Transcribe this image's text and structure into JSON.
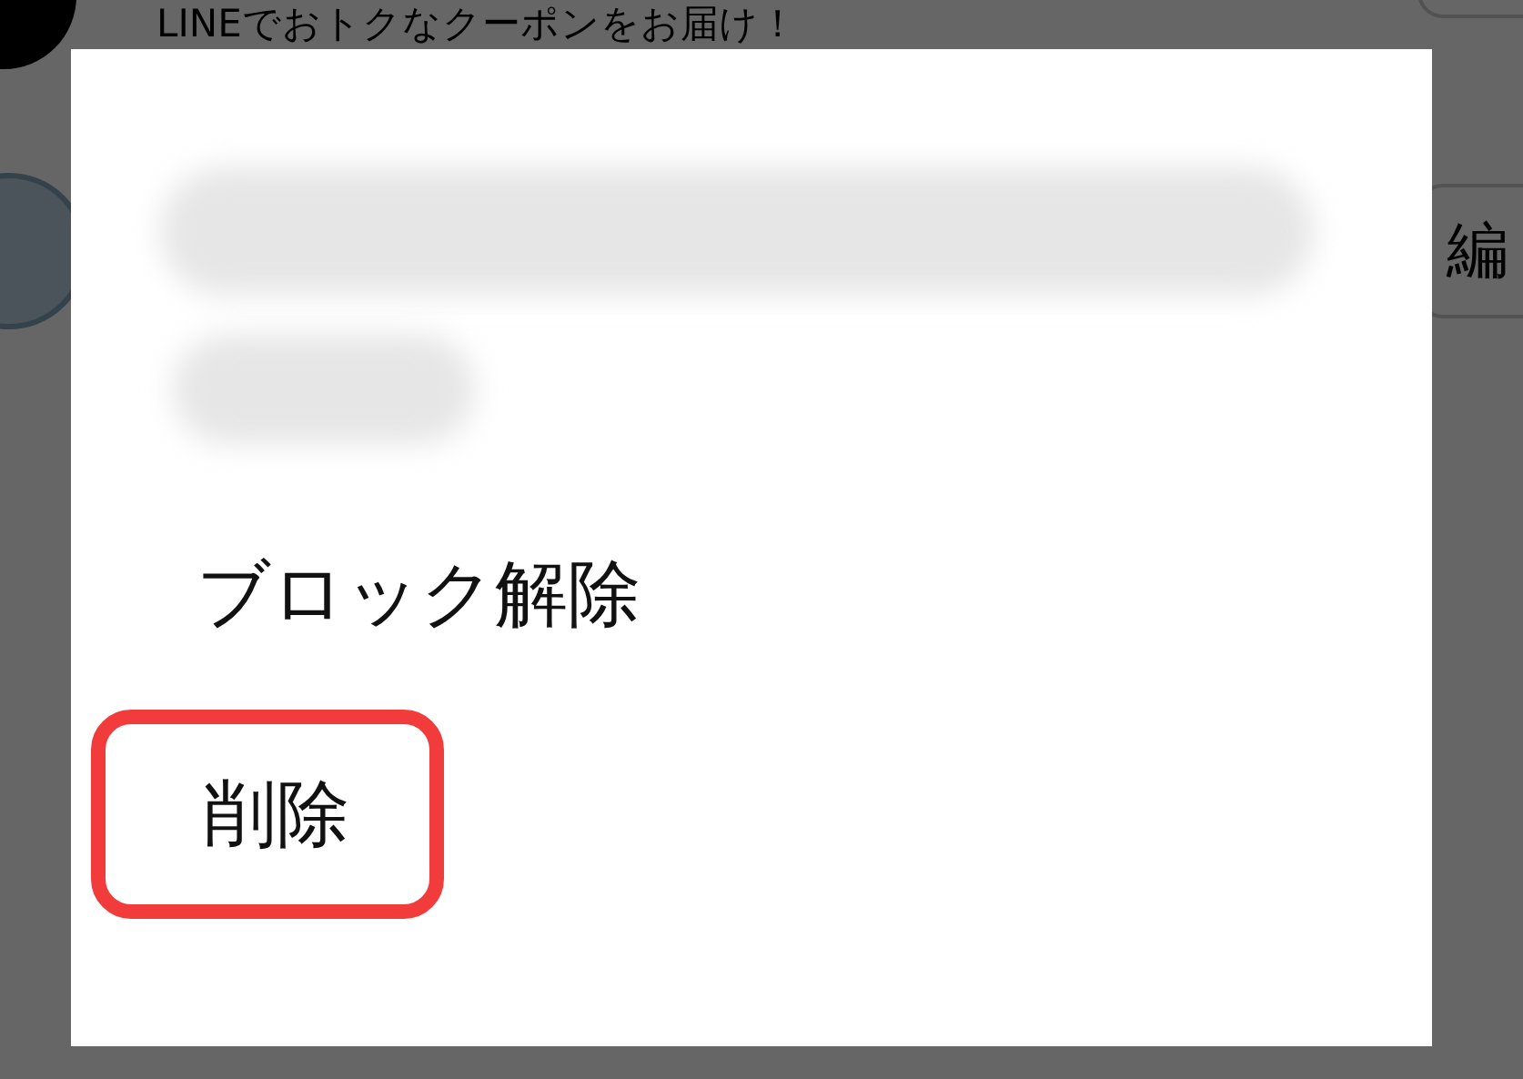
{
  "background_list": [
    {
      "kind": "message",
      "text": "LINEでおトクなクーポンをお届け！"
    },
    {
      "kind": "action",
      "button": "編"
    }
  ],
  "dialog": {
    "menu": [
      {
        "label": "ブロック解除",
        "highlighted": false
      },
      {
        "label": "削除",
        "highlighted": true
      }
    ]
  }
}
